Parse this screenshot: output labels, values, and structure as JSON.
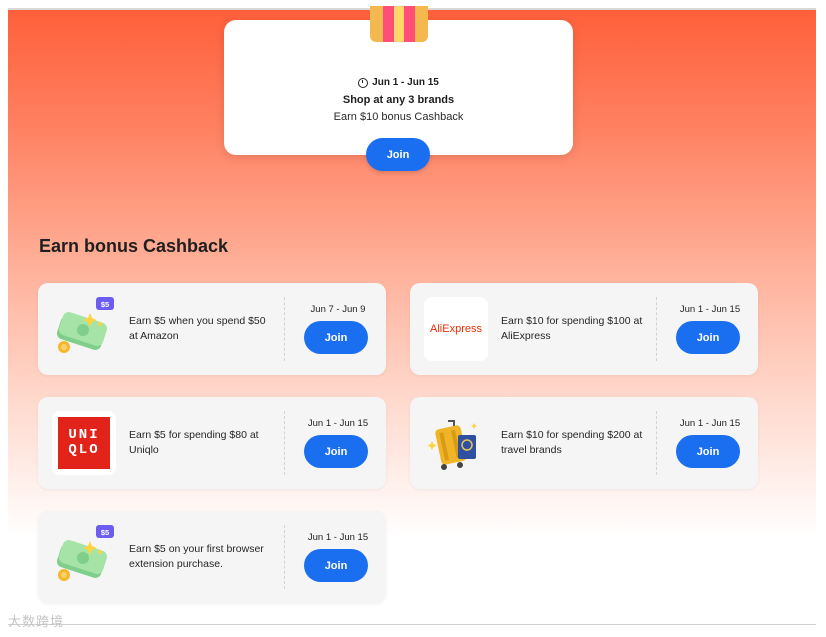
{
  "promo": {
    "date": "Jun 1 - Jun 15",
    "title": "Shop at any 3 brands",
    "subtitle": "Earn $10 bonus Cashback",
    "join_label": "Join"
  },
  "section": {
    "title": "Earn bonus Cashback"
  },
  "offers": [
    {
      "icon": "cash-bills-icon",
      "badge": "$5",
      "text": "Earn $5 when you spend $50 at Amazon",
      "date": "Jun 7 - Jun 9",
      "join_label": "Join"
    },
    {
      "icon": "aliexpress-logo",
      "logo_text": "AliExpress",
      "text": "Earn $10 for spending $100 at AliExpress",
      "date": "Jun 1 - Jun 15",
      "join_label": "Join"
    },
    {
      "icon": "uniqlo-logo",
      "logo_line1": "UNI",
      "logo_line2": "QLO",
      "text": "Earn $5 for spending $80 at Uniqlo",
      "date": "Jun 1 - Jun 15",
      "join_label": "Join"
    },
    {
      "icon": "luggage-passport-icon",
      "text": "Earn $10 for spending $200 at travel brands",
      "date": "Jun 1 - Jun 15",
      "join_label": "Join"
    },
    {
      "icon": "cash-bills-icon",
      "badge": "$5",
      "text": "Earn $5 on your first browser extension purchase.",
      "date": "Jun 1 - Jun 15",
      "join_label": "Join"
    }
  ],
  "watermark": "大数跨境",
  "colors": {
    "accent": "#1a6ff0",
    "header_top": "#ff5f3a",
    "card_bg": "#f5f5f5"
  }
}
